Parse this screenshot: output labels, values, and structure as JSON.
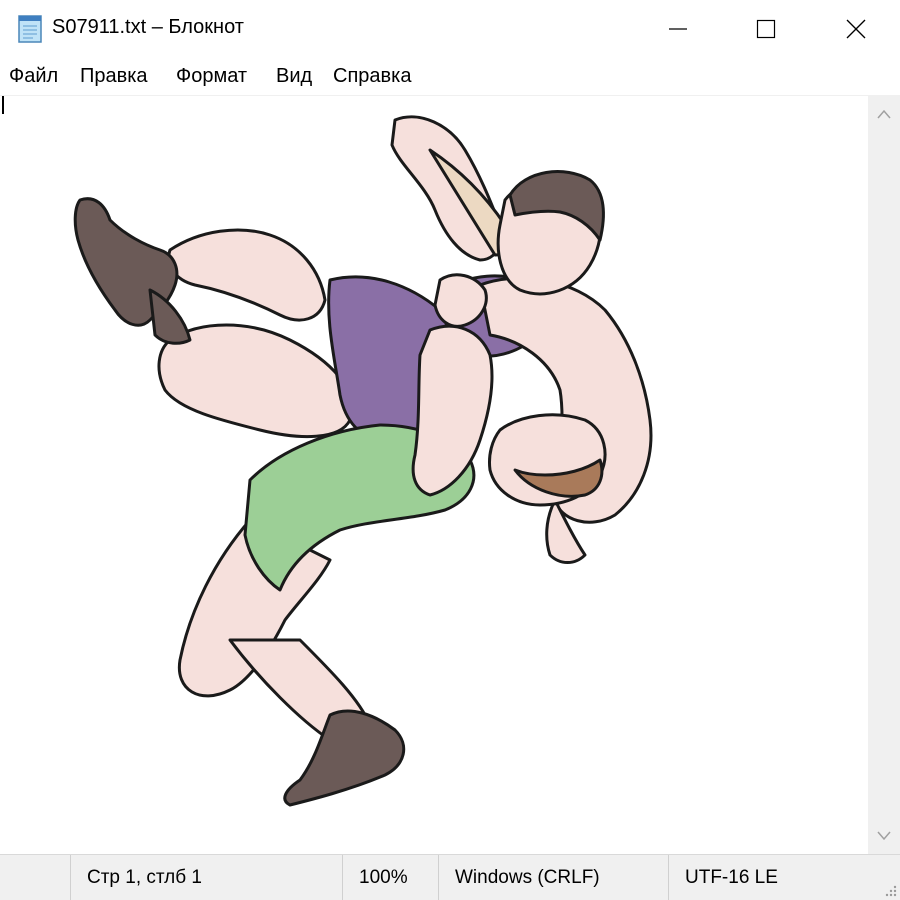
{
  "window": {
    "title": "S07911.txt – Блокнот",
    "icon": "notepad-icon",
    "controls": [
      "minimize-icon",
      "maximize-icon",
      "close-icon"
    ]
  },
  "menu": {
    "items": [
      "Файл",
      "Правка",
      "Формат",
      "Вид",
      "Справка"
    ]
  },
  "editor": {
    "content_image": "wrestlers-illustration"
  },
  "statusbar": {
    "position": "Стр 1, стлб 1",
    "zoom": "100%",
    "line_endings": "Windows (CRLF)",
    "encoding": "UTF-16 LE"
  },
  "colors": {
    "chrome": "#f0f0f0",
    "singlet_purple": "#8a6fa6",
    "singlet_green": "#9ccf96",
    "skin": "#f6e0dc",
    "outline": "#1a1a1a"
  }
}
